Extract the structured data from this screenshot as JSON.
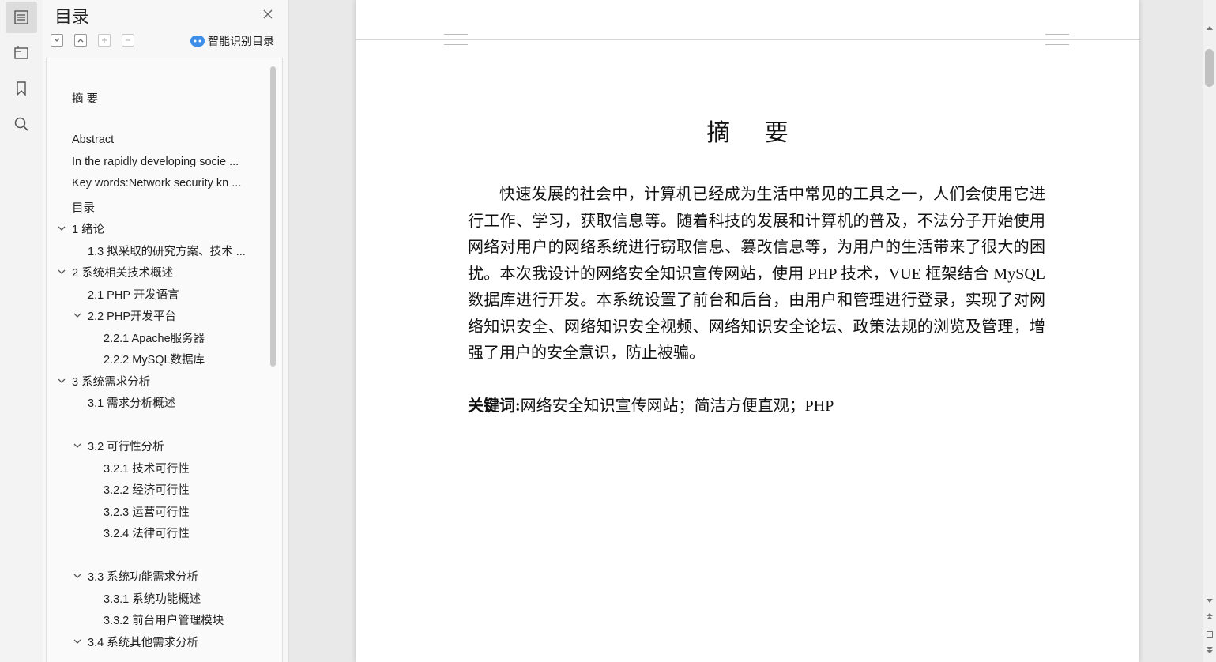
{
  "toc_panel": {
    "title": "目录",
    "smart_label": "智能识别目录",
    "items": [
      {
        "label": "摘  要",
        "level": 0,
        "expandable": false
      },
      {
        "label": "Abstract",
        "level": 0,
        "expandable": false
      },
      {
        "label": "In the rapidly developing socie ...",
        "level": 0,
        "expandable": false
      },
      {
        "label": "Key words:Network security kn ...",
        "level": 0,
        "expandable": false
      },
      {
        "label": "目录",
        "level": 0,
        "expandable": false
      },
      {
        "label": "1 绪论",
        "level": 0,
        "expandable": true
      },
      {
        "label": "1.3  拟采取的研究方案、技术 ...",
        "level": 1,
        "expandable": false
      },
      {
        "label": "2 系统相关技术概述",
        "level": 0,
        "expandable": true
      },
      {
        "label": "2.1 PHP 开发语言",
        "level": 1,
        "expandable": false
      },
      {
        "label": "2.2    PHP开发平台",
        "level": 1,
        "expandable": true
      },
      {
        "label": "2.2.1    Apache服务器",
        "level": 2,
        "expandable": false
      },
      {
        "label": "2.2.2    MySQL数据库",
        "level": 2,
        "expandable": false
      },
      {
        "label": "3 系统需求分析",
        "level": 0,
        "expandable": true
      },
      {
        "label": "3.1 需求分析概述",
        "level": 1,
        "expandable": false
      },
      {
        "label": "3.2 可行性分析",
        "level": 1,
        "expandable": true
      },
      {
        "label": "3.2.1 技术可行性",
        "level": 2,
        "expandable": false
      },
      {
        "label": "3.2.2 经济可行性",
        "level": 2,
        "expandable": false
      },
      {
        "label": "3.2.3 运营可行性",
        "level": 2,
        "expandable": false
      },
      {
        "label": "3.2.4 法律可行性",
        "level": 2,
        "expandable": false
      },
      {
        "label": "3.3 系统功能需求分析",
        "level": 1,
        "expandable": true
      },
      {
        "label": "3.3.1 系统功能概述",
        "level": 2,
        "expandable": false
      },
      {
        "label": "3.3.2 前台用户管理模块",
        "level": 2,
        "expandable": false
      },
      {
        "label": "3.4 系统其他需求分析",
        "level": 1,
        "expandable": true
      }
    ]
  },
  "document": {
    "title": "摘  要",
    "body": "快速发展的社会中，计算机已经成为生活中常见的工具之一，人们会使用它进行工作、学习，获取信息等。随着科技的发展和计算机的普及，不法分子开始使用网络对用户的网络系统进行窃取信息、篡改信息等，为用户的生活带来了很大的困扰。本次我设计的网络安全知识宣传网站，使用 PHP 技术，VUE 框架结合 MySQL 数据库进行开发。本系统设置了前台和后台，由用户和管理进行登录，实现了对网络知识安全、网络知识安全视频、网络知识安全论坛、政策法规的浏览及管理，增强了用户的安全意识，防止被骗。",
    "keywords_label": "关键词:",
    "keywords": "网络安全知识宣传网站；简洁方便直观；PHP"
  },
  "icons": {
    "sidebar": [
      "toc-icon",
      "outline-icon",
      "bookmark-icon",
      "search-icon"
    ]
  }
}
